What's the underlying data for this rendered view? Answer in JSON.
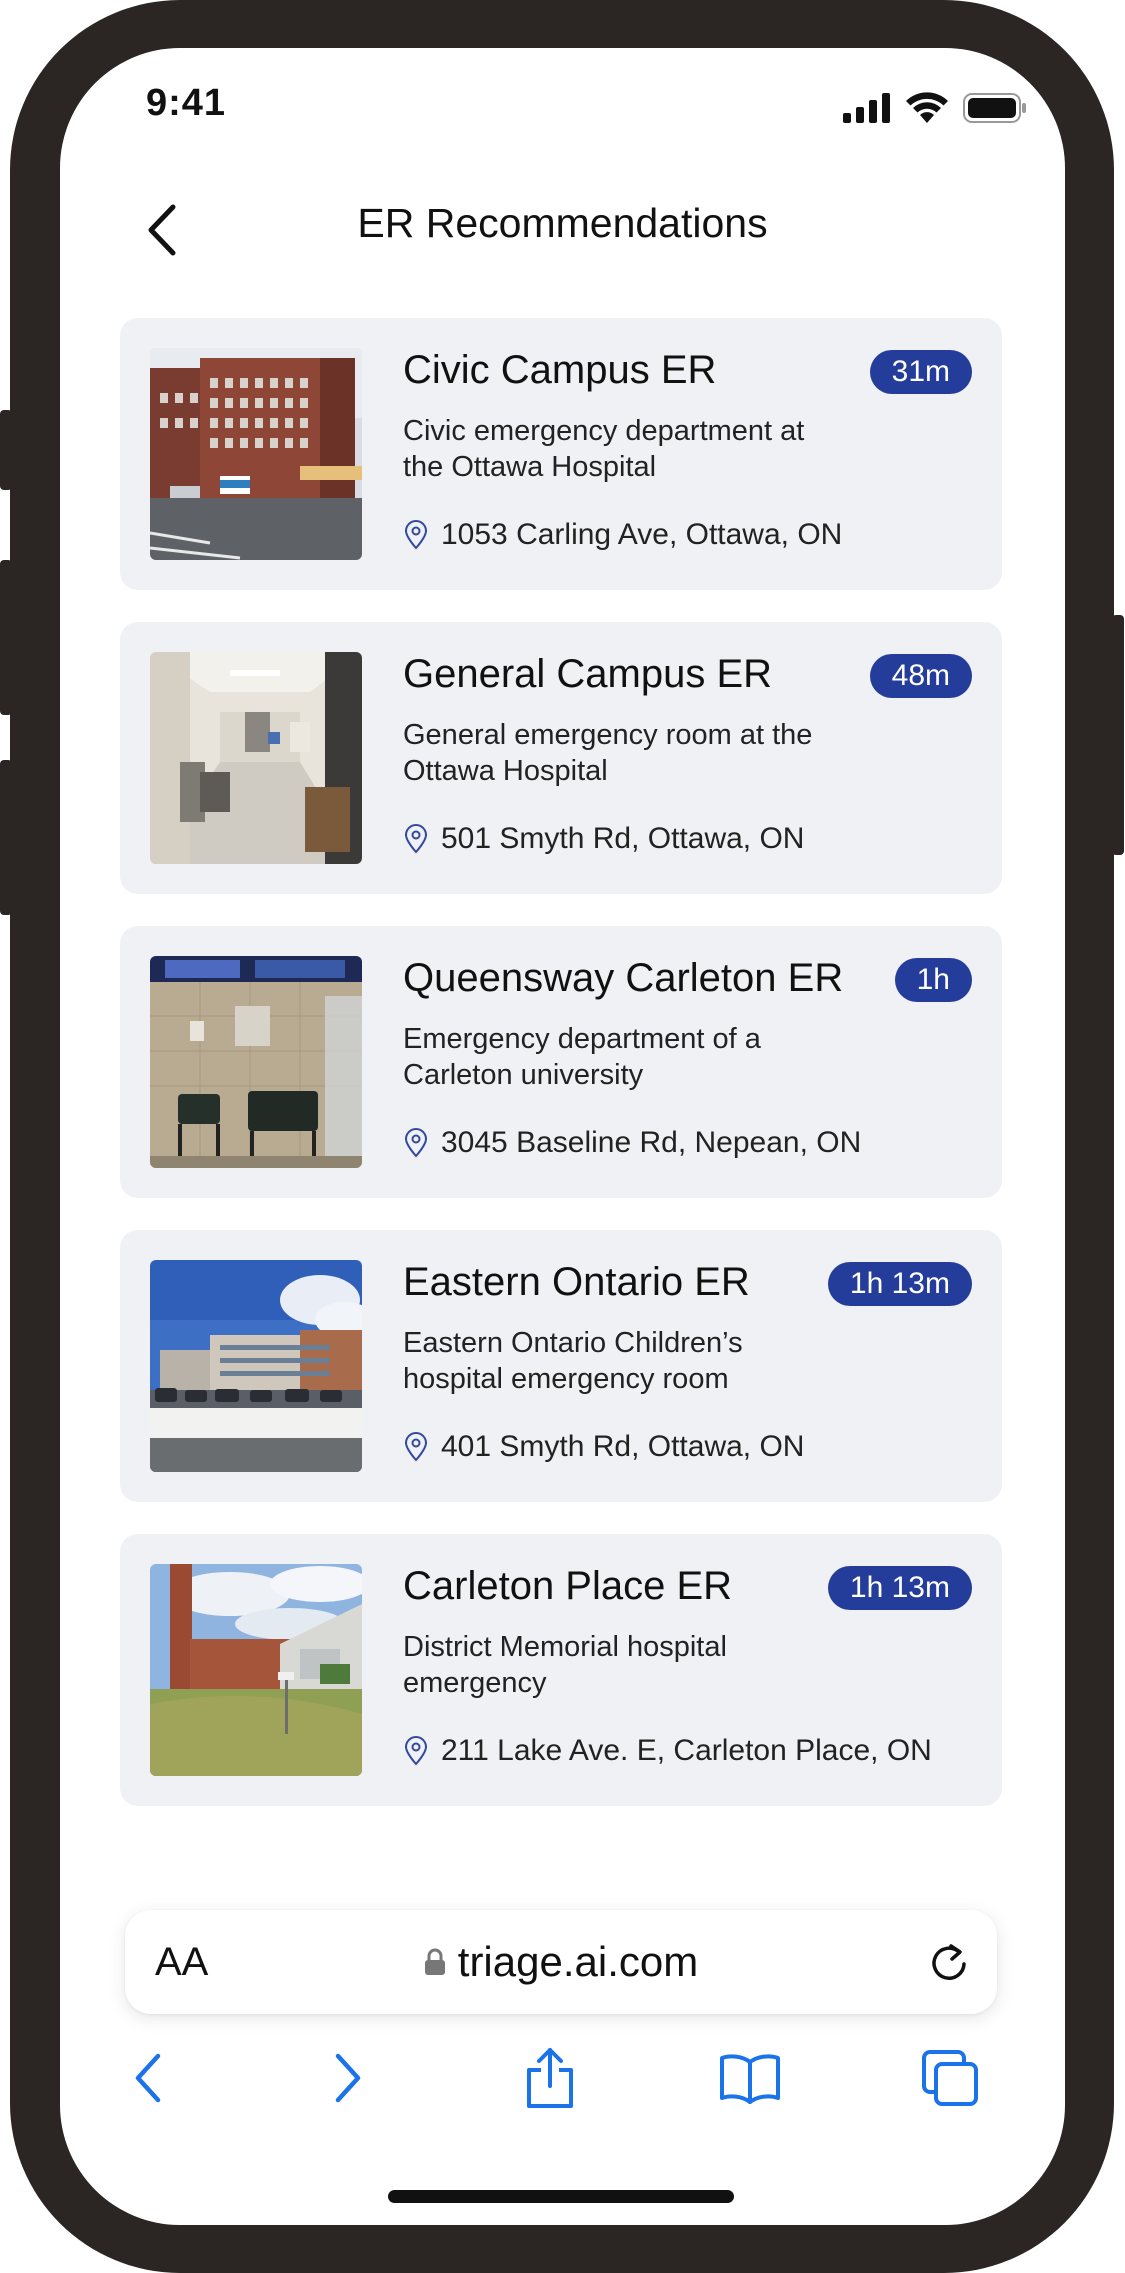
{
  "status_bar": {
    "time": "9:41",
    "icons": [
      "cellular-signal-icon",
      "wifi-icon",
      "battery-icon"
    ]
  },
  "header": {
    "title": "ER Recommendations",
    "back_icon": "chevron-left-icon"
  },
  "colors": {
    "badge_bg": "#253d9a",
    "card_bg": "#f0f1f5",
    "frame": "#2b2523",
    "toolbar_blue": "#1a73e8"
  },
  "er_list": [
    {
      "name": "Civic Campus ER",
      "wait": "31m",
      "description": "Civic emergency department at the Ottawa Hospital",
      "address": "1053 Carling Ave, Ottawa, ON",
      "image": "hospital-building-photo"
    },
    {
      "name": "General Campus ER",
      "wait": "48m",
      "description": "General emergency room at the Ottawa Hospital",
      "address": "501 Smyth Rd, Ottawa, ON",
      "image": "hospital-hallway-photo"
    },
    {
      "name": "Queensway Carleton ER",
      "wait": "1h",
      "description": "Emergency department of a Carleton university",
      "address": "3045 Baseline Rd, Nepean, ON",
      "image": "waiting-room-photo"
    },
    {
      "name": "Eastern Ontario ER",
      "wait": "1h 13m",
      "description": "Eastern Ontario Children’s hospital emergency room",
      "address": "401 Smyth Rd, Ottawa, ON",
      "image": "hospital-parking-lot-photo"
    },
    {
      "name": "Carleton Place ER",
      "wait": "1h 13m",
      "description": "District Memorial hospital emergency",
      "address": "211 Lake Ave. E, Carleton Place, ON",
      "image": "hospital-exterior-lawn-photo"
    }
  ],
  "browser": {
    "text_size_label": "AA",
    "url": "triage.ai.com",
    "lock_icon": "lock-icon",
    "reload_icon": "reload-icon",
    "toolbar_icons": [
      "back-arrow-icon",
      "forward-arrow-icon",
      "share-icon",
      "bookmarks-icon",
      "tabs-icon"
    ]
  }
}
